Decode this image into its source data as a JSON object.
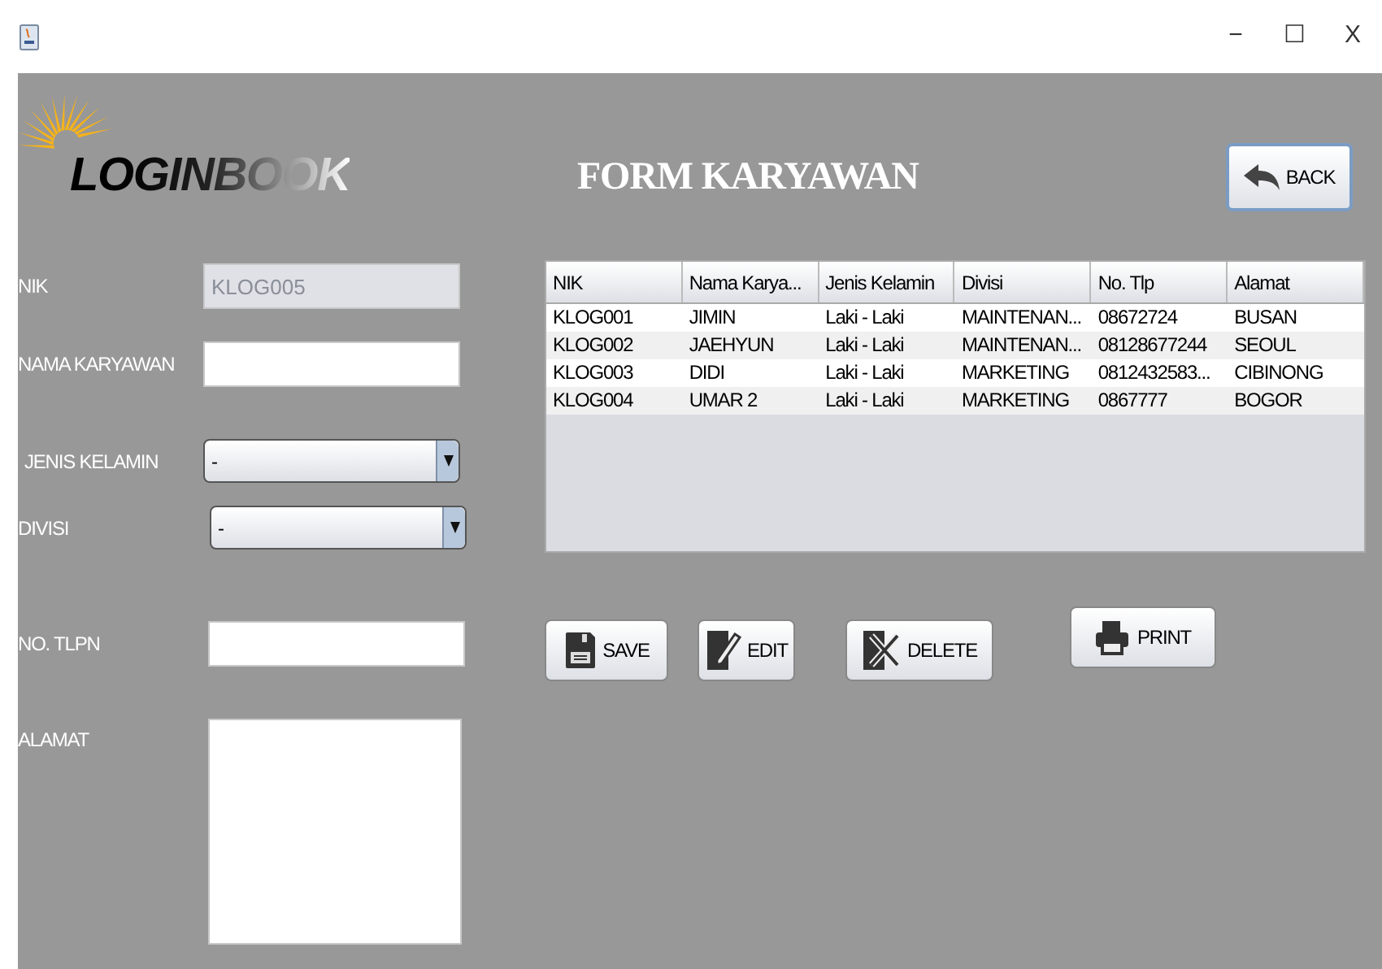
{
  "window": {
    "controls": [
      "−",
      "☐",
      "X"
    ]
  },
  "logo": {
    "text": "LOGINBOOK"
  },
  "title": "FORM KARYAWAN",
  "back_button": "BACK",
  "form": [
    {
      "label": "NIK",
      "kind": "text",
      "value": "KLOG005",
      "disabled": true
    },
    {
      "label": "NAMA KARYAWAN",
      "kind": "text",
      "disabled": false
    },
    {
      "label": "JENIS KELAMIN",
      "kind": "combo",
      "value": "-",
      "disabled": false
    },
    {
      "label": "DIVISI",
      "kind": "combo",
      "value": "-",
      "disabled": false
    },
    {
      "label": "NO. TLPN",
      "kind": "text",
      "disabled": false
    },
    {
      "label": "ALAMAT",
      "kind": "area",
      "disabled": false
    }
  ],
  "table": {
    "columns": [
      "NIK",
      "Nama Karya...",
      "Jenis Kelamin",
      "Divisi",
      "No. Tlp",
      "Alamat"
    ],
    "rows": [
      [
        "KLOG001",
        "JIMIN",
        "Laki - Laki",
        "MAINTENAN...",
        "08672724",
        "BUSAN"
      ],
      [
        "KLOG002",
        "JAEHYUN",
        "Laki - Laki",
        "MAINTENAN...",
        "08128677244",
        "SEOUL"
      ],
      [
        "KLOG003",
        "DIDI",
        "Laki - Laki",
        "MARKETING",
        "0812432583...",
        "CIBINONG"
      ],
      [
        "KLOG004",
        "UMAR 2",
        "Laki - Laki",
        "MARKETING",
        "0867777",
        "BOGOR"
      ]
    ]
  },
  "actions": [
    {
      "label": "SAVE",
      "kind": "save"
    },
    {
      "label": "EDIT",
      "kind": "edit"
    },
    {
      "label": "DELETE",
      "kind": "delete"
    },
    {
      "label": "PRINT",
      "kind": "print"
    }
  ]
}
